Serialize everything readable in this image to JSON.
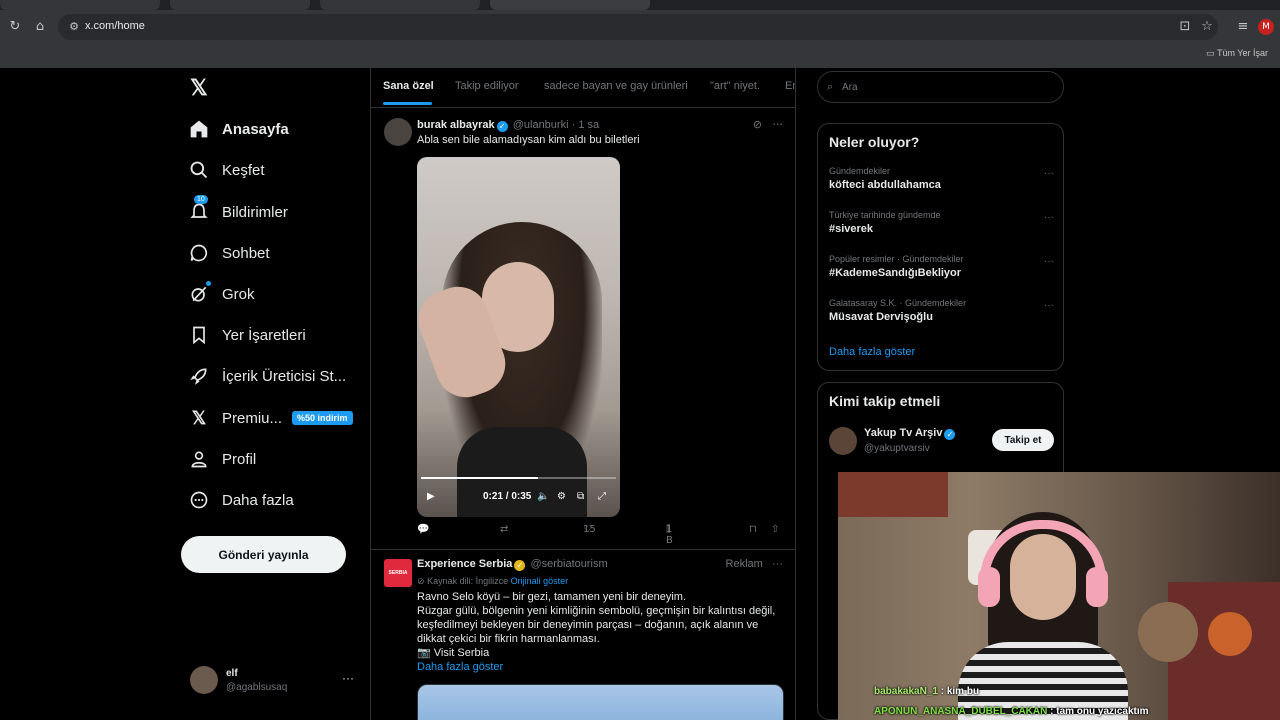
{
  "browser": {
    "url": "x.com/home",
    "bookmarks_label": "Tüm Yer İşar"
  },
  "nav": {
    "items": [
      {
        "label": "Anasayfa"
      },
      {
        "label": "Keşfet"
      },
      {
        "label": "Bildirimler",
        "badge": "10"
      },
      {
        "label": "Sohbet"
      },
      {
        "label": "Grok"
      },
      {
        "label": "Yer İşaretleri"
      },
      {
        "label": "İçerik Üreticisi St..."
      },
      {
        "label": "Premiu...",
        "promo": "%50 indirim"
      },
      {
        "label": "Profil"
      },
      {
        "label": "Daha fazla"
      }
    ],
    "post_button": "Gönderi yayınla",
    "account": {
      "name": "elf",
      "handle": "@agablsusaq"
    }
  },
  "tabs": [
    "Sana özel",
    "Takip ediliyor",
    "sadece bayan ve gay ürünleri",
    "\"art\" niyet.",
    "En"
  ],
  "tweet1": {
    "name": "burak albayrak",
    "handle": "@ulanburki",
    "time": "· 1 sa",
    "text": "Abla sen bile alamadıysan kim aldı bu biletleri",
    "video_time": "0:21 / 0:35",
    "video_progress": 0.6,
    "likes": "15",
    "views": "1 B"
  },
  "tweet2": {
    "name": "Experience Serbia",
    "handle": "@serbiatourism",
    "ad_label": "Reklam",
    "avatar_text": "SERBIA",
    "lang_note": "Kaynak dili: İngilizce",
    "show_original": "Orijinali göster",
    "line1": "Ravno Selo köyü – bir gezi, tamamen yeni bir deneyim.",
    "line2": "Rüzgar gülü, bölgenin yeni kimliğinin sembolü, geçmişin bir kalıntısı değil,",
    "line3": "keşfedilmeyi bekleyen bir deneyimin parçası – doğanın, açık alanın ve",
    "line4": "dikkat çekici bir fikrin harmanlanması.",
    "link_line": "📷 Visit Serbia",
    "show_more": "Daha fazla göster"
  },
  "search": {
    "placeholder": "Ara"
  },
  "trends": {
    "title": "Neler oluyor?",
    "items": [
      {
        "context": "Gündemdekiler",
        "topic": "köfteci abdullahamca"
      },
      {
        "context": "Türkiye tarihinde gündemde",
        "topic": "#siverek"
      },
      {
        "context": "Popüler resimler · Gündemdekiler",
        "topic": "#KademeSandığıBekliyor"
      },
      {
        "context": "Galatasaray S.K. · Gündemdekiler",
        "topic": "Müsavat Dervişoğlu"
      }
    ],
    "show_more": "Daha fazla göster"
  },
  "who_to_follow": {
    "title": "Kimi takip etmeli",
    "name": "Yakup Tv Arşiv",
    "handle": "@yakuptvarsiv",
    "button": "Takip et"
  },
  "stream_chat": [
    {
      "user": "babakakaN_1",
      "message": ": kim bu"
    },
    {
      "user": "APONUN_ANASNA_DUBEL_CAKAN",
      "message": ": tam onu yazıcaktım"
    }
  ],
  "colors": {
    "accent": "#1d9bf0",
    "background": "#000000"
  }
}
